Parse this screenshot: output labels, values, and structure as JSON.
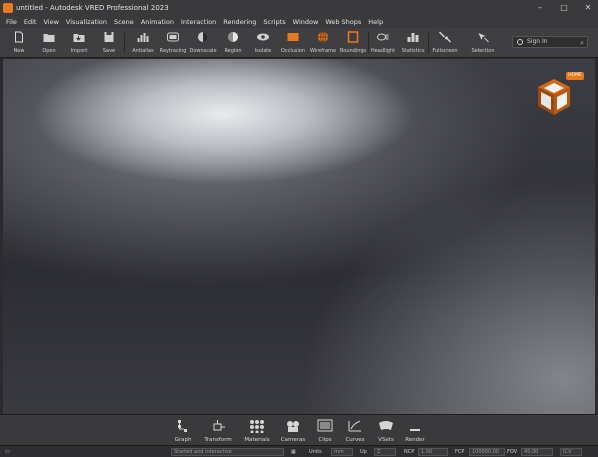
{
  "window": {
    "title": "untitled - Autodesk VRED Professional 2023",
    "minimize": "–",
    "maximize": "□",
    "close": "✕"
  },
  "menu": [
    "File",
    "Edit",
    "View",
    "Visualization",
    "Scene",
    "Animation",
    "Interaction",
    "Rendering",
    "Scripts",
    "Window",
    "Web Shops",
    "Help"
  ],
  "toolbar": {
    "items": [
      {
        "label": "New",
        "icon": "new-file-icon"
      },
      {
        "label": "Open",
        "icon": "folder-open-icon"
      },
      {
        "label": "Import",
        "icon": "import-icon"
      },
      {
        "label": "Save",
        "icon": "save-icon"
      },
      {
        "label": "Antialias",
        "icon": "antialias-icon"
      },
      {
        "label": "Raytracing",
        "icon": "raytracing-icon"
      },
      {
        "label": "Downscale",
        "icon": "downscale-icon"
      },
      {
        "label": "Region",
        "icon": "region-icon"
      },
      {
        "label": "Isolate",
        "icon": "isolate-icon"
      },
      {
        "label": "Occlusion",
        "icon": "occlusion-icon"
      },
      {
        "label": "Wireframe",
        "icon": "wireframe-icon"
      },
      {
        "label": "Boundings",
        "icon": "boundings-icon"
      },
      {
        "label": "Headlight",
        "icon": "headlight-icon"
      },
      {
        "label": "Statistics",
        "icon": "statistics-icon"
      },
      {
        "label": "Fullscreen",
        "icon": "fullscreen-icon"
      },
      {
        "label": "Selection",
        "icon": "selection-icon"
      }
    ],
    "signin": "Sign In"
  },
  "viewport": {
    "navcube_label": "HOME"
  },
  "modules": [
    {
      "label": "Graph",
      "icon": "graph-icon"
    },
    {
      "label": "Transform",
      "icon": "transform-icon"
    },
    {
      "label": "Materials",
      "icon": "materials-icon"
    },
    {
      "label": "Cameras",
      "icon": "cameras-icon"
    },
    {
      "label": "Clips",
      "icon": "clips-icon"
    },
    {
      "label": "Curves",
      "icon": "curves-icon"
    },
    {
      "label": "VSets",
      "icon": "vsets-icon"
    },
    {
      "label": "Render",
      "icon": "render-icon"
    }
  ],
  "status": {
    "command_placeholder": "Started and interactive",
    "units_label": "Units",
    "units_value": "mm",
    "up_label": "Up",
    "up_value": "Z",
    "ncp_label": "NCP",
    "ncp_value": "1.00",
    "fcp_label": "FCP",
    "fcp_value": "100000.00",
    "fov_label": "FOV",
    "fov_value": "45.00",
    "ics_label": "ICV"
  },
  "colors": {
    "accent": "#e87a1e",
    "chrome": "#3a3a3c",
    "viewport": "#2e2e35"
  }
}
